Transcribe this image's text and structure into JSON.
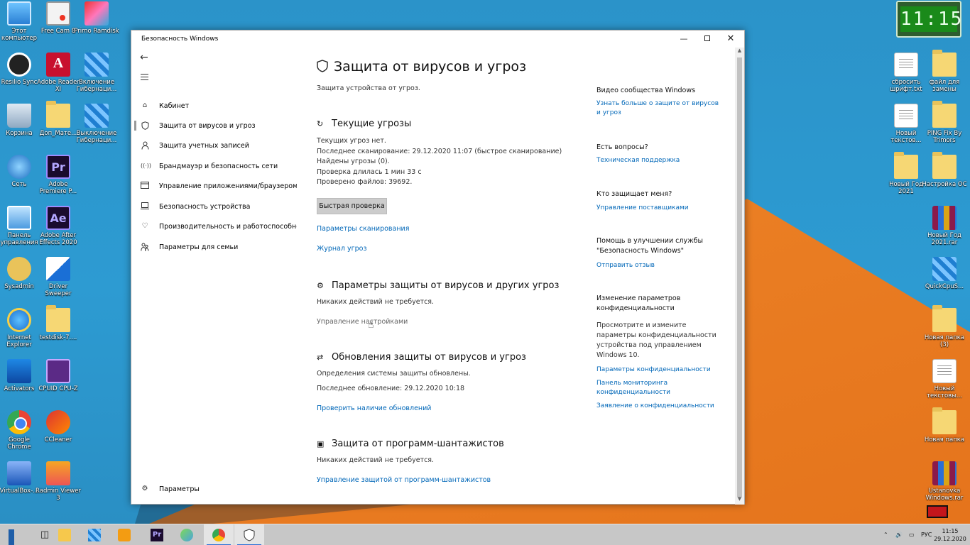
{
  "desktop": {
    "left_icons": [
      {
        "label": "Этот компьютер",
        "icon": "pc"
      },
      {
        "label": "Free Cam 8",
        "icon": "cam"
      },
      {
        "label": "Primo Ramdisk",
        "icon": "primo"
      },
      {
        "label": "Resilio Sync",
        "icon": "sync"
      },
      {
        "label": "Adobe Reader XI",
        "icon": "adobe"
      },
      {
        "label": "Включение Гибернаци...",
        "icon": "blocks"
      },
      {
        "label": "Корзина",
        "icon": "bin"
      },
      {
        "label": "Доп_Мате...",
        "icon": "folder"
      },
      {
        "label": "Выключение Гибернаци...",
        "icon": "blocks"
      },
      {
        "label": "Сеть",
        "icon": "net"
      },
      {
        "label": "Adobe Premiere P...",
        "icon": "pr"
      },
      {
        "label": "Панель управления",
        "icon": "panel"
      },
      {
        "label": "Adobe After Effects 2020",
        "icon": "ae"
      },
      {
        "label": "Sysadmin",
        "icon": "sys"
      },
      {
        "label": "Driver Sweeper",
        "icon": "drv"
      },
      {
        "label": "Internet Explorer",
        "icon": "ie"
      },
      {
        "label": "testdisk-7....",
        "icon": "folder"
      },
      {
        "label": "Activators",
        "icon": "keys"
      },
      {
        "label": "CPUID CPU-Z",
        "icon": "cpuz"
      },
      {
        "label": "Google Chrome",
        "icon": "chrome"
      },
      {
        "label": "CCleaner",
        "icon": "cc"
      },
      {
        "label": "VirtualBox-...",
        "icon": "vbox"
      },
      {
        "label": "Radmin Viewer 3",
        "icon": "radmin"
      }
    ],
    "right_icons": [
      {
        "label": "сбросить шрифт.txt",
        "icon": "txt"
      },
      {
        "label": "файл для замены",
        "icon": "folder"
      },
      {
        "label": "Новый текстов...",
        "icon": "txt"
      },
      {
        "label": "PING Fix By Trimors",
        "icon": "folder"
      },
      {
        "label": "Новый Год 2021",
        "icon": "folder"
      },
      {
        "label": "Настройка ОС",
        "icon": "folder"
      },
      {
        "label": "Новый Год 2021.rar",
        "icon": "rar"
      },
      {
        "label": "QuickCpuS...",
        "icon": "cpu-tool"
      },
      {
        "label": "Новая папка (3)",
        "icon": "folder"
      },
      {
        "label": "Новый текстовы...",
        "icon": "txt"
      },
      {
        "label": "Новая папка",
        "icon": "folder"
      },
      {
        "label": "Ustanovka Windows.rar",
        "icon": "rar"
      }
    ],
    "clock_widget": "11:15"
  },
  "window": {
    "title": "Безопасность Windows",
    "nav": [
      {
        "label": "Кабинет",
        "icon": "home-icon"
      },
      {
        "label": "Защита от вирусов и угроз",
        "icon": "shield-icon"
      },
      {
        "label": "Защита учетных записей",
        "icon": "person-icon"
      },
      {
        "label": "Брандмауэр и безопасность сети",
        "icon": "wifi-icon"
      },
      {
        "label": "Управление приложениями/браузером",
        "icon": "app-window-icon"
      },
      {
        "label": "Безопасность устройства",
        "icon": "laptop-icon"
      },
      {
        "label": "Производительность и работоспособность",
        "icon": "heart-icon"
      },
      {
        "label": "Параметры для семьи",
        "icon": "family-icon"
      }
    ],
    "settings_label": "Параметры",
    "main": {
      "title": "Защита от вирусов и угроз",
      "subtitle": "Защита устройства от угроз.",
      "current_threats": {
        "title": "Текущие угрозы",
        "lines": [
          "Текущих угроз нет.",
          "Последнее сканирование: 29.12.2020 11:07 (быстрое сканирование)",
          "Найдены угрозы (0).",
          "Проверка длилась 1 мин 33 с",
          "Проверено файлов: 39692."
        ],
        "quick_scan": "Быстрая проверка",
        "scan_options": "Параметры сканирования",
        "threat_history": "Журнал угроз"
      },
      "settings": {
        "title": "Параметры защиты от вирусов и других угроз",
        "status": "Никаких действий не требуется.",
        "manage": "Управление настройками"
      },
      "updates": {
        "title": "Обновления защиты от вирусов и угроз",
        "status": "Определения системы защиты обновлены.",
        "last_update": "Последнее обновление: 29.12.2020 10:18",
        "check": "Проверить наличие обновлений"
      },
      "ransomware": {
        "title": "Защита от программ-шантажистов",
        "status": "Никаких действий не требуется.",
        "manage": "Управление защитой от программ-шантажистов"
      }
    },
    "right": {
      "community_title": "Видео сообщества Windows",
      "community_link": "Узнать больше о защите от вирусов и угроз",
      "questions_title": "Есть вопросы?",
      "questions_link": "Техническая поддержка",
      "who_title": "Кто защищает меня?",
      "who_link": "Управление поставщиками",
      "improve_title": "Помощь в улучшении службы \"Безопасность Windows\"",
      "improve_link": "Отправить отзыв",
      "privacy_title": "Изменение параметров конфиденциальности",
      "privacy_text": "Просмотрите и измените параметры конфиденциальности устройства под управлением Windows 10.",
      "privacy_links": [
        "Параметры конфиденциальности",
        "Панель мониторинга конфиденциальности",
        "Заявление о конфиденциальности"
      ]
    }
  },
  "taskbar": {
    "language": "РУС",
    "time": "11:15",
    "date": "29.12.2020",
    "apps": [
      "start",
      "task-view",
      "file-explorer",
      "archive-tool",
      "media-player",
      "premiere",
      "paint-tool",
      "chrome",
      "windows-security"
    ]
  }
}
